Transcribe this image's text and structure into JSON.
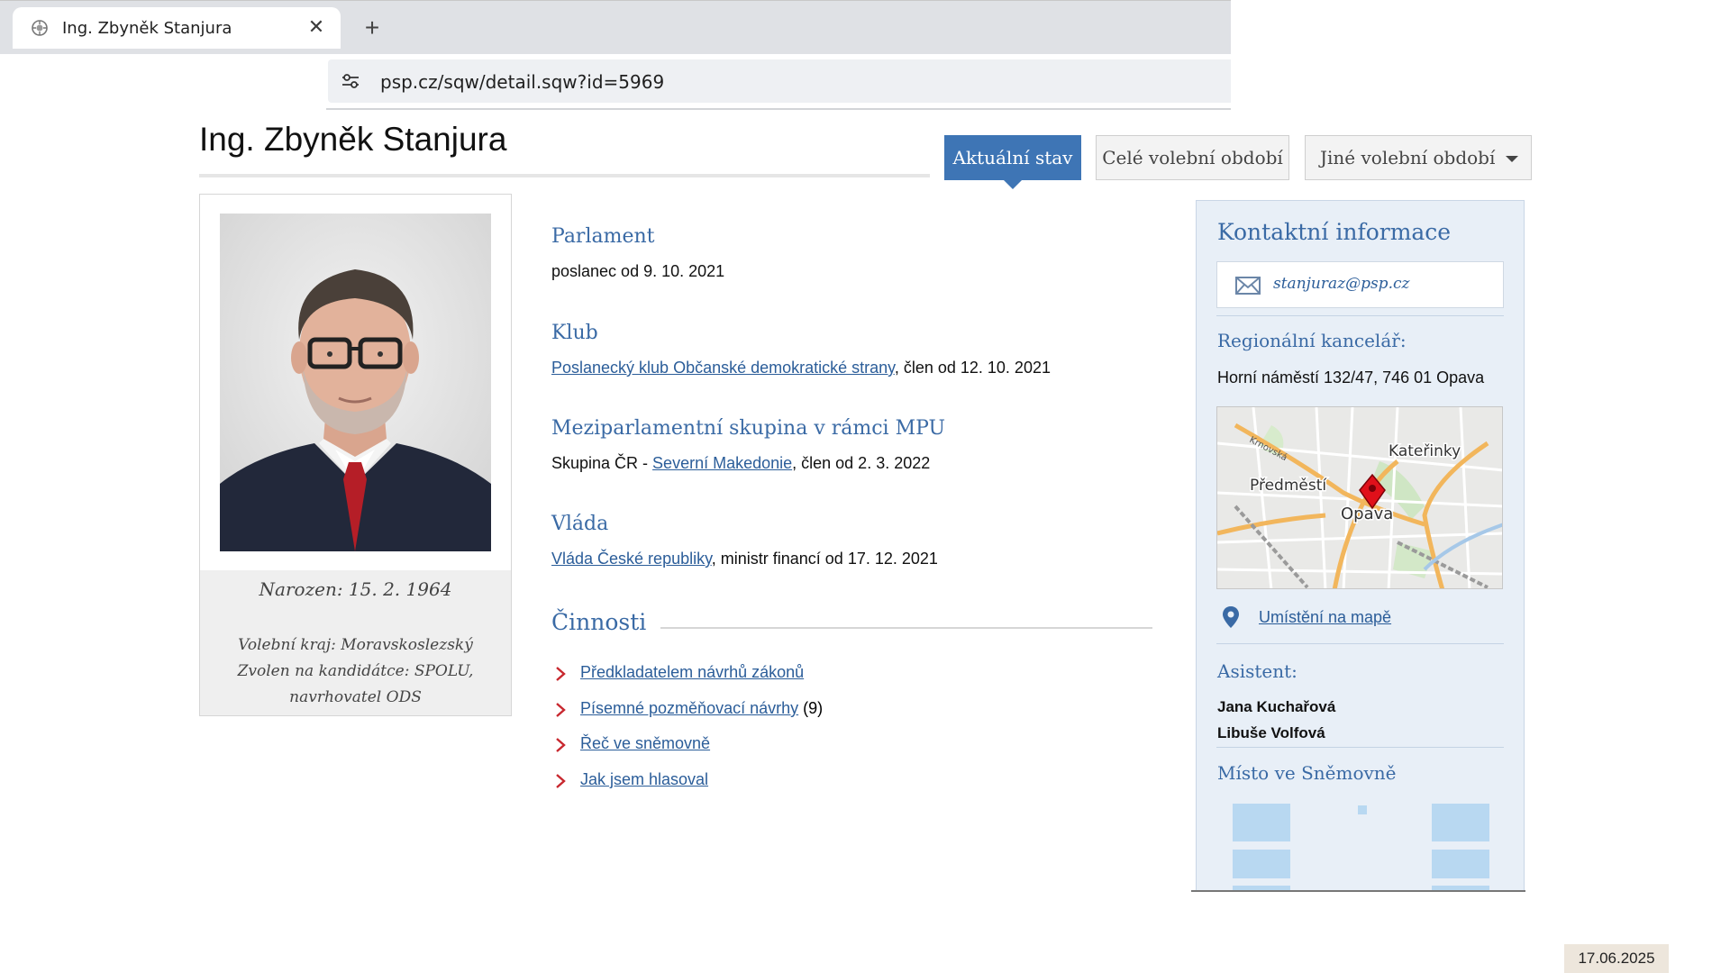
{
  "browser": {
    "tab_title": "Ing. Zbyněk Stanjura",
    "tab_close": "✕",
    "new_tab": "+",
    "url": "psp.cz/sqw/detail.sqw?id=5969"
  },
  "header": {
    "title": "Ing. Zbyněk Stanjura",
    "tabs": [
      {
        "label": "Aktuální stav",
        "active": true
      },
      {
        "label": "Celé volební období",
        "active": false
      },
      {
        "label": "Jiné volební období",
        "active": false
      }
    ]
  },
  "profile": {
    "born": "Narozen: 15. 2. 1964",
    "lines": [
      "Volební kraj: Moravskoslezský",
      "Zvolen na kandidátce: SPOLU,",
      "navrhovatel ODS"
    ]
  },
  "sections": {
    "parlament": {
      "heading": "Parlament",
      "text": "poslanec od 9. 10. 2021"
    },
    "klub": {
      "heading": "Klub",
      "link": "Poslanecký klub Občanské demokratické strany",
      "text": ", člen od 12. 10. 2021"
    },
    "mpu": {
      "heading": "Meziparlamentní skupina v rámci MPU",
      "prefix": "Skupina ČR - ",
      "link": "Severní Makedonie",
      "text": ", člen od 2. 3. 2022"
    },
    "vlada": {
      "heading": "Vláda",
      "link": "Vláda České republiky",
      "text": ", ministr financí od 17. 12. 2021"
    }
  },
  "activities": {
    "heading": "Činnosti",
    "items": [
      {
        "label": "Předkladatelem návrhů zákonů",
        "suffix": ""
      },
      {
        "label": "Písemné pozměňovací návrhy",
        "suffix": " (9)"
      },
      {
        "label": "Řeč ve sněmovně",
        "suffix": ""
      },
      {
        "label": "Jak jsem hlasoval",
        "suffix": ""
      }
    ]
  },
  "contact": {
    "heading": "Kontaktní informace",
    "email": "stanjuraz@psp.cz",
    "office_heading": "Regionální kancelář:",
    "office_address": "Horní náměstí 132/47, 746 01  Opava",
    "map_labels": {
      "katerinky": "Kateřinky",
      "predmesti": "Předměstí",
      "opava": "Opava",
      "krnovska": "Krnovská"
    },
    "map_link": "Umístění na mapě",
    "assistant_heading": "Asistent:",
    "assistants": [
      "Jana Kuchařová",
      "Libuše Volfová"
    ],
    "seat_heading": "Místo ve Sněmovně"
  },
  "footer": {
    "date": "17.06.2025"
  },
  "colors": {
    "accent": "#3e75b5",
    "link": "#2b5d99",
    "heading": "#3a6aa5",
    "panel": "#e8eff7"
  }
}
